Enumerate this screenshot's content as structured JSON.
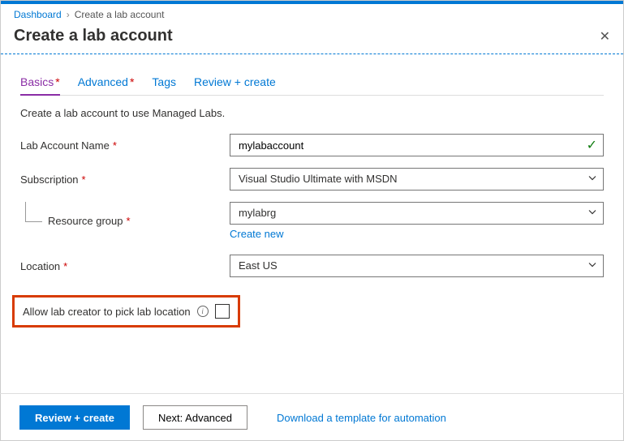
{
  "breadcrumb": {
    "root": "Dashboard",
    "current": "Create a lab account"
  },
  "page": {
    "title": "Create a lab account"
  },
  "tabs": {
    "basics": "Basics",
    "advanced": "Advanced",
    "tags": "Tags",
    "review": "Review + create"
  },
  "form": {
    "description": "Create a lab account to use Managed Labs.",
    "name_label": "Lab Account Name",
    "name_value": "mylabaccount",
    "subscription_label": "Subscription",
    "subscription_value": "Visual Studio Ultimate with MSDN",
    "rg_label": "Resource group",
    "rg_value": "mylabrg",
    "rg_create_new": "Create new",
    "location_label": "Location",
    "location_value": "East US",
    "pick_location_label": "Allow lab creator to pick lab location"
  },
  "footer": {
    "review": "Review + create",
    "next": "Next: Advanced",
    "download": "Download a template for automation"
  }
}
